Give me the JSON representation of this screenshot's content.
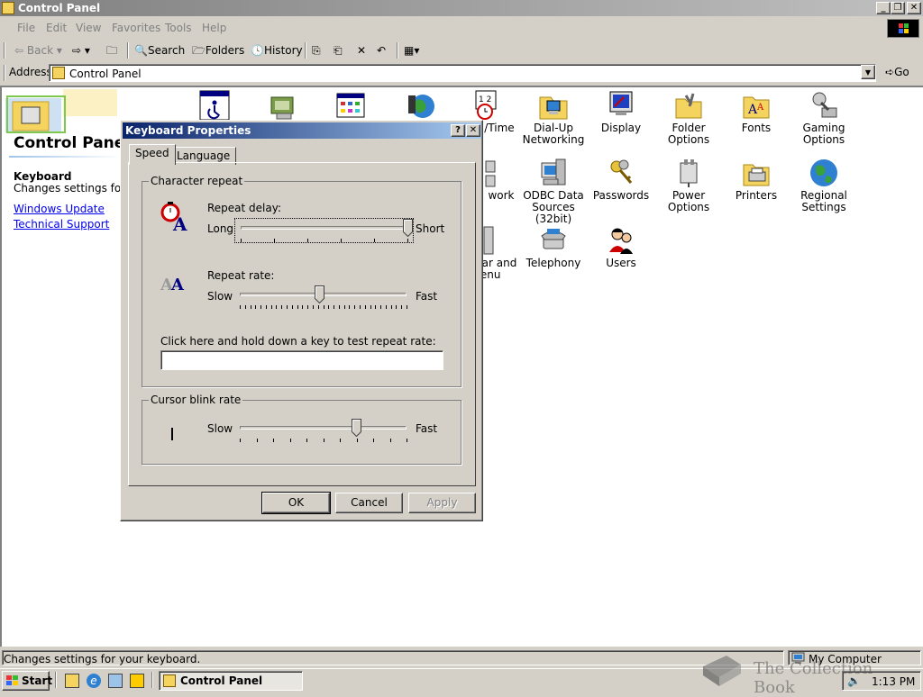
{
  "window": {
    "title": "Control Panel"
  },
  "menu": [
    "File",
    "Edit",
    "View",
    "Favorites",
    "Tools",
    "Help"
  ],
  "toolbar": {
    "back": "Back",
    "search": "Search",
    "folders": "Folders",
    "history": "History"
  },
  "address": {
    "label": "Address",
    "value": "Control Panel",
    "go": "Go"
  },
  "left_pane": {
    "title": "Control Panel",
    "item_name": "Keyboard",
    "item_desc": "Changes settings for you",
    "links": [
      "Windows Update",
      "Technical Support"
    ]
  },
  "icons": {
    "row1": [
      "",
      "",
      "",
      "",
      "/Time",
      "Dial-Up Networking",
      "Display",
      "Folder Options",
      "Fonts",
      "Gaming Options"
    ],
    "row2": [
      "work",
      "ODBC Data Sources (32bit)",
      "Passwords",
      "Power Options",
      "Printers",
      "Regional Settings"
    ],
    "row3": [
      "ar and Menu",
      "Telephony",
      "Users"
    ]
  },
  "dialog": {
    "title": "Keyboard Properties",
    "tabs": [
      "Speed",
      "Language"
    ],
    "char_group": "Character repeat",
    "repeat_delay": {
      "label": "Repeat delay:",
      "min_label": "Long",
      "max_label": "Short",
      "value": 1.0
    },
    "repeat_rate": {
      "label": "Repeat rate:",
      "min_label": "Slow",
      "max_label": "Fast",
      "value": 0.48
    },
    "test_label": "Click here and hold down a key to test repeat rate:",
    "test_value": "",
    "cursor_group": "Cursor blink rate",
    "cursor_blink": {
      "min_label": "Slow",
      "max_label": "Fast",
      "value": 0.7
    },
    "buttons": {
      "ok": "OK",
      "cancel": "Cancel",
      "apply": "Apply"
    }
  },
  "status": {
    "left": "Changes settings for your keyboard.",
    "right": "My Computer"
  },
  "taskbar": {
    "start": "Start",
    "app": "Control Panel",
    "time": "1:13 PM"
  },
  "watermark": "The Collection Book"
}
